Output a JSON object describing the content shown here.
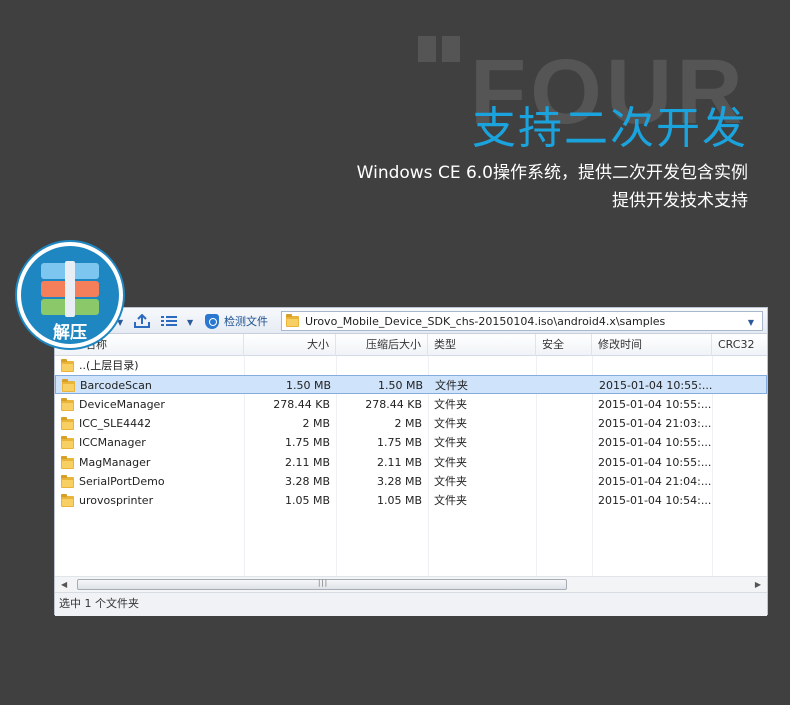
{
  "hero": {
    "bg_word": "FOUR",
    "headline": "支持二次开发",
    "sub_line1": "Windows CE 6.0操作系统，提供二次开发包含实例",
    "sub_line2": "提供开发技术支持"
  },
  "badge": {
    "label": "解压"
  },
  "toolbar": {
    "detect_label": "检测文件",
    "path": "Urovo_Mobile_Device_SDK_chs-20150104.iso\\android4.x\\samples"
  },
  "columns": [
    "名称",
    "大小",
    "压缩后大小",
    "类型",
    "安全",
    "修改时间",
    "CRC32"
  ],
  "rows": [
    {
      "name": "..(上层目录)",
      "size": "",
      "packed": "",
      "type": "",
      "modified": ""
    },
    {
      "name": "BarcodeScan",
      "size": "1.50 MB",
      "packed": "1.50 MB",
      "type": "文件夹",
      "modified": "2015-01-04 10:55:..."
    },
    {
      "name": "DeviceManager",
      "size": "278.44 KB",
      "packed": "278.44 KB",
      "type": "文件夹",
      "modified": "2015-01-04 10:55:..."
    },
    {
      "name": "ICC_SLE4442",
      "size": "2 MB",
      "packed": "2 MB",
      "type": "文件夹",
      "modified": "2015-01-04 21:03:..."
    },
    {
      "name": "ICCManager",
      "size": "1.75 MB",
      "packed": "1.75 MB",
      "type": "文件夹",
      "modified": "2015-01-04 10:55:..."
    },
    {
      "name": "MagManager",
      "size": "2.11 MB",
      "packed": "2.11 MB",
      "type": "文件夹",
      "modified": "2015-01-04 10:55:..."
    },
    {
      "name": "SerialPortDemo",
      "size": "3.28 MB",
      "packed": "3.28 MB",
      "type": "文件夹",
      "modified": "2015-01-04 21:04:..."
    },
    {
      "name": "urovosprinter",
      "size": "1.05 MB",
      "packed": "1.05 MB",
      "type": "文件夹",
      "modified": "2015-01-04 10:54:..."
    }
  ],
  "selected_row": 1,
  "status": {
    "text": "选中 1 个文件夹"
  },
  "colors": {
    "accent": "#1ba3dd",
    "selection": "#cfe3fa",
    "badge": "#1e86c0"
  }
}
